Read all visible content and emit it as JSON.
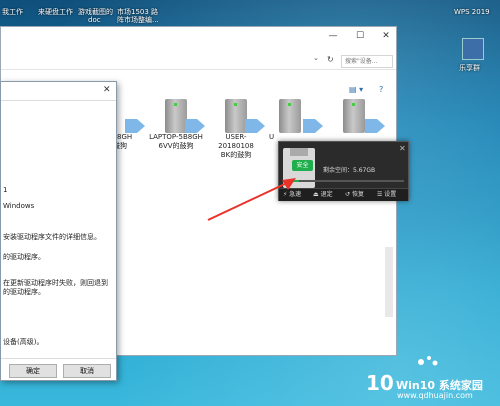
{
  "desktop": {
    "icons": [
      {
        "label": "我工作"
      },
      {
        "label": "来硬盘工作"
      },
      {
        "label": "游戏截图的"
      },
      {
        "label": "doc"
      },
      {
        "label": "市场1503 路"
      },
      {
        "label": "阵市场整编..."
      },
      {
        "label": "WPS 2019"
      },
      {
        "label": "乐享群"
      }
    ]
  },
  "explorer": {
    "search_placeholder": "搜索\"设备...",
    "drives": [
      {
        "label": "5B8GH",
        "sub": "鼓狗"
      },
      {
        "label": "LAPTOP-5B8GH",
        "sub": "6VV的鼓狗"
      },
      {
        "label": "USER-20180108",
        "sub": "BK的鼓狗"
      },
      {
        "label": "U",
        "sub": ""
      }
    ]
  },
  "properties": {
    "lines": [
      "1",
      "Windows",
      "安装驱动程序文件的详细信息。",
      "的驱动程序。",
      "在更新驱动程序时失败，则回退到",
      "的驱动程序。",
      "设备(高级)。"
    ],
    "ok_label": "确定",
    "cancel_label": "取消"
  },
  "widget": {
    "badge": "安全",
    "free_space": "剩余空间：5.67GB",
    "actions": [
      "急速",
      "退定",
      "恢复",
      "设置"
    ],
    "used_fraction": 0.1
  },
  "watermark": {
    "logo": "10",
    "title": "Win10 系统家园",
    "url": "www.qdhuajin.com"
  }
}
